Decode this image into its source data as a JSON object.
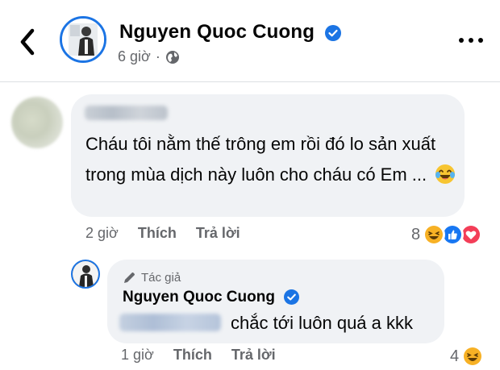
{
  "header": {
    "name": "Nguyen Quoc Cuong",
    "time": "6 giờ",
    "separator": "·"
  },
  "comments": [
    {
      "author_visible": false,
      "text": "Cháu tôi nằm thế trông em rồi đó lo sản xuất trong mùa dịch này luôn cho cháu có Em ...",
      "emoji": "laughing-tears",
      "time": "2 giờ",
      "like_label": "Thích",
      "reply_label": "Trả lời",
      "reaction_count": "8",
      "reactions": [
        "haha",
        "like",
        "love"
      ]
    }
  ],
  "reply": {
    "badge": "Tác giả",
    "name": "Nguyen Quoc Cuong",
    "text": "chắc tới luôn quá a kkk",
    "time": "1 giờ",
    "like_label": "Thích",
    "reply_label": "Trả lời",
    "reaction_count": "4",
    "reactions": [
      "haha"
    ]
  },
  "colors": {
    "accent": "#1b74e4",
    "bubble": "#f0f2f5",
    "secondary_text": "#65676b",
    "haha": "#f7b125",
    "love": "#f33e58"
  }
}
